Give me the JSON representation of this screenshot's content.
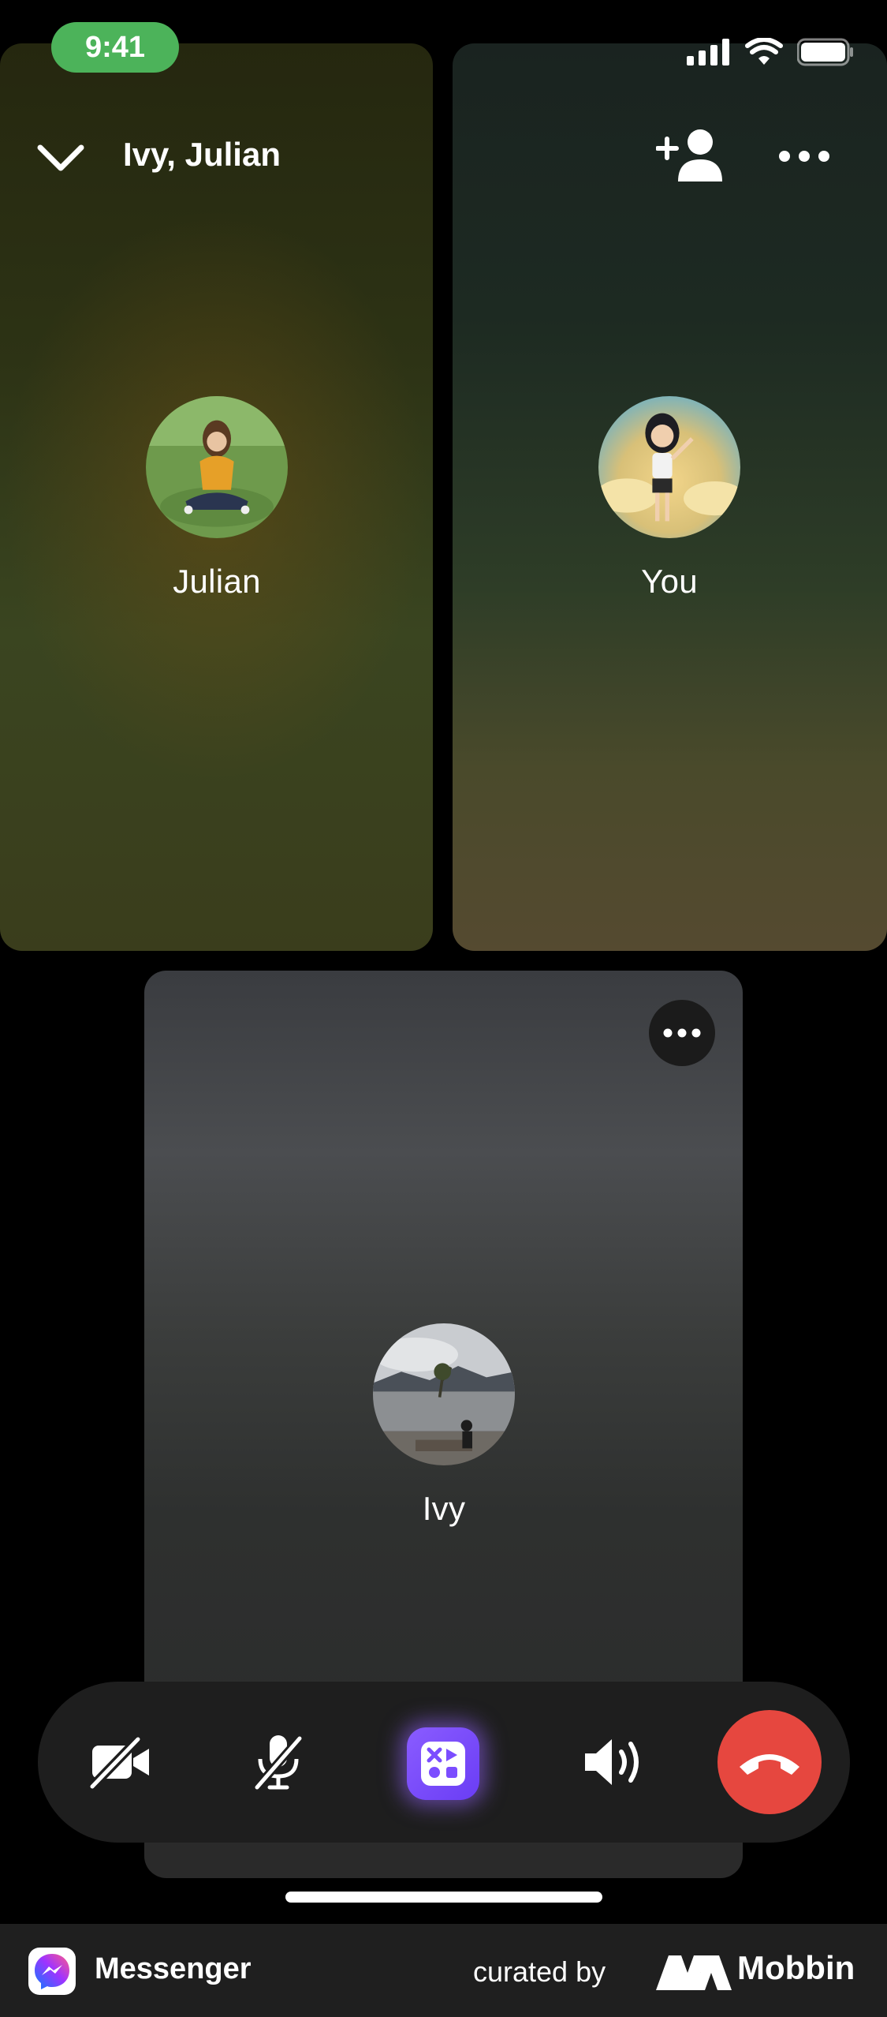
{
  "status_bar": {
    "time": "9:41"
  },
  "header": {
    "title": "Ivy, Julian"
  },
  "participants": [
    {
      "name": "Julian"
    },
    {
      "name": "You"
    },
    {
      "name": "Ivy"
    }
  ],
  "controls": {
    "camera": "camera-off-icon",
    "mute": "microphone-off-icon",
    "effects": "effects-icon",
    "speaker": "speaker-icon",
    "end": "end-call-icon"
  },
  "footer": {
    "app_name": "Messenger",
    "curated_label": "curated by",
    "brand": "Mobbin"
  },
  "colors": {
    "time_pill": "#4cb35a",
    "end_call": "#e6473f",
    "effects": "#7b4dff"
  }
}
